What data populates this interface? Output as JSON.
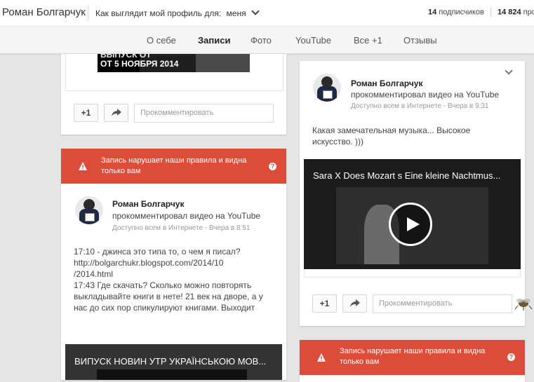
{
  "header": {
    "name": "Роман Болгарчук",
    "view_as_label": "Как выглядит мой профиль для:",
    "view_as_value": "меня",
    "followers_count": "14",
    "followers_label": "подписчиков",
    "views_count": "14 824",
    "views_label": "просм"
  },
  "tabs": [
    "О себе",
    "Записи",
    "Фото",
    "YouTube",
    "Все +1",
    "Отзывы"
  ],
  "active_tab": "Записи",
  "left_top_card": {
    "thumb_line1": "ВЫПУСК ОТ",
    "thumb_line2": "ОТ 5 НОЯБРЯ 2014",
    "plus_one": "+1",
    "comment_placeholder": "Прокомментировать"
  },
  "left_post": {
    "warning_text": "Запись нарушает наши правила и видна только вам",
    "warning_help": "?",
    "author": "Роман Болгарчук",
    "action": "прокомментировал видео на YouTube",
    "visibility": "Доступно всем в Интернете",
    "time": "Вчера в 8:51",
    "body_lines": [
      "17:10 - джинса это типа то, о чем я писал?",
      "http://bolgarchukr.blogspot.com/2014/10",
      "/2014.html",
      "17:43 Где скачать? Сколько можно повторять",
      "выкладывайте книги в нете! 21 век на дворе, а у",
      "нас до сих пор спикулируют книгами. Выходит"
    ],
    "video_title": "ВИПУСК НОВИН УТР УКРАЇНСЬКОЮ МОВ..."
  },
  "right_post": {
    "author": "Роман Болгарчук",
    "action": "прокомментировал видео на YouTube",
    "visibility": "Доступно всем в Интернете",
    "time": "Вчера в 9:31",
    "body_lines": [
      "Какая замечательная музыка... Высокое",
      "искусство. )))"
    ],
    "video_title": "Sara X Does Mozart s Eine kleine Nachtmus...",
    "plus_one": "+1",
    "comment_placeholder": "Прокомментировать"
  },
  "right_bottom_warning": {
    "text": "Запись нарушает наши правила и видна только вам",
    "help": "?"
  },
  "colors": {
    "warning_red": "#dd4b39",
    "page_bg": "#e5e5e5"
  }
}
